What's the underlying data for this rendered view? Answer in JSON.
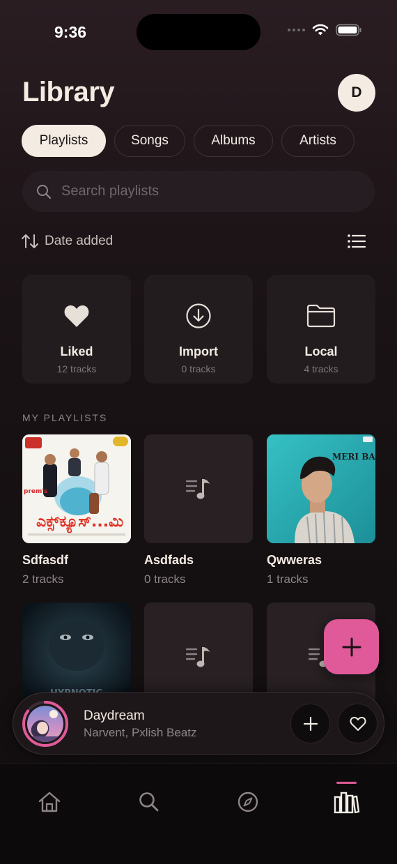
{
  "status_bar": {
    "time": "9:36"
  },
  "header": {
    "title": "Library",
    "avatar_letter": "D"
  },
  "tabs": [
    {
      "label": "Playlists",
      "active": true
    },
    {
      "label": "Songs",
      "active": false
    },
    {
      "label": "Albums",
      "active": false
    },
    {
      "label": "Artists",
      "active": false
    }
  ],
  "search": {
    "placeholder": "Search playlists",
    "value": ""
  },
  "sort": {
    "label": "Date added"
  },
  "quick_access": [
    {
      "name": "Liked",
      "count": "12 tracks",
      "icon": "heart-icon"
    },
    {
      "name": "Import",
      "count": "0 tracks",
      "icon": "download-icon"
    },
    {
      "name": "Local",
      "count": "4 tracks",
      "icon": "folder-icon"
    }
  ],
  "section": {
    "label": "MY PLAYLISTS"
  },
  "playlists": [
    {
      "name": "Sdfasdf",
      "count": "2 tracks",
      "cover": "movie-poster-art"
    },
    {
      "name": "Asdfads",
      "count": "0 tracks",
      "cover": "music-note-placeholder"
    },
    {
      "name": "Qwweras",
      "count": "1 tracks",
      "cover": "portrait-album-art",
      "cover_text": "MERI BANOGI KYA"
    },
    {
      "name": "",
      "count": "",
      "cover": "veiled-face-art",
      "cover_text": "HYPNOTIC"
    },
    {
      "name": "",
      "count": "",
      "cover": "music-note-placeholder"
    },
    {
      "name": "",
      "count": "",
      "cover": "music-note-placeholder"
    }
  ],
  "now_playing": {
    "title": "Daydream",
    "artist": "Narvent, Pxlish Beatz",
    "progress": 0.85
  },
  "bottom_nav": [
    {
      "name": "home-icon",
      "active": false
    },
    {
      "name": "search-icon",
      "active": false
    },
    {
      "name": "compass-icon",
      "active": false
    },
    {
      "name": "library-icon",
      "active": true
    }
  ],
  "colors": {
    "accent": "#e05a99",
    "cream": "#f4ece2",
    "background": "#151012"
  }
}
